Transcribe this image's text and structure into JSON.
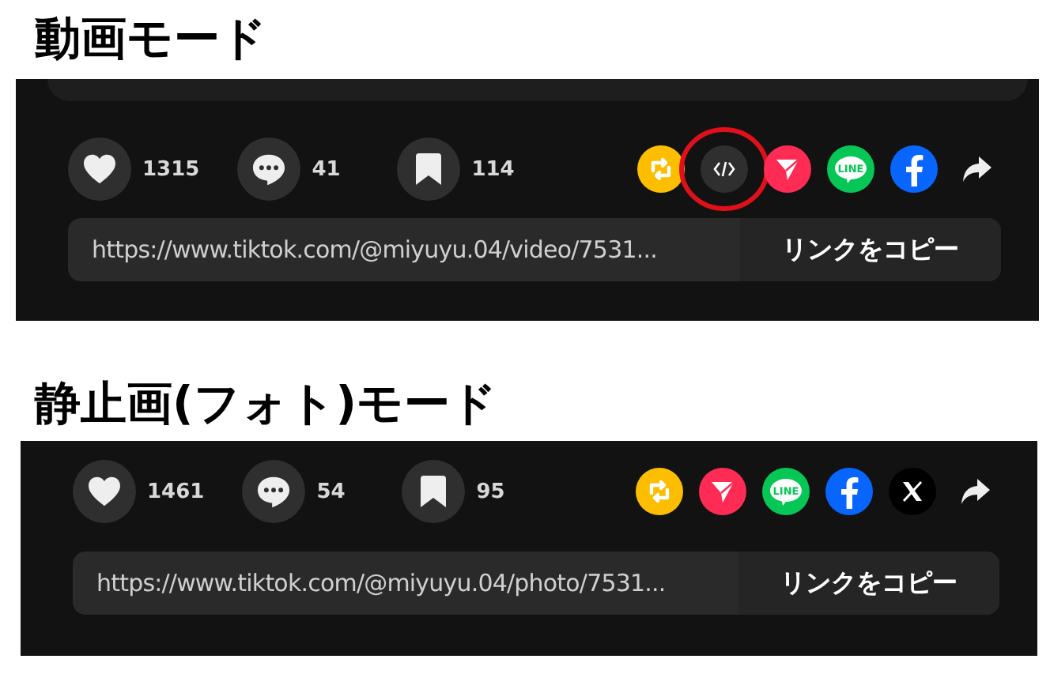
{
  "sections": [
    {
      "title": "動画モード",
      "top_card": true,
      "stats": [
        {
          "kind": "like",
          "count": "1315"
        },
        {
          "kind": "comment",
          "count": "41"
        },
        {
          "kind": "bookmark",
          "count": "114"
        }
      ],
      "share": [
        {
          "kind": "repost",
          "highlighted": false
        },
        {
          "kind": "embed",
          "highlighted": true
        },
        {
          "kind": "send",
          "highlighted": false
        },
        {
          "kind": "line",
          "label": "LINE",
          "highlighted": false
        },
        {
          "kind": "facebook",
          "highlighted": false
        },
        {
          "kind": "more",
          "highlighted": false
        }
      ],
      "url": "https://www.tiktok.com/@miyuyu.04/video/7531...",
      "copy_label": "リンクをコピー"
    },
    {
      "title": "静止画(フォト)モード",
      "top_card": false,
      "stats": [
        {
          "kind": "like",
          "count": "1461"
        },
        {
          "kind": "comment",
          "count": "54"
        },
        {
          "kind": "bookmark",
          "count": "95"
        }
      ],
      "share": [
        {
          "kind": "repost",
          "highlighted": false
        },
        {
          "kind": "send",
          "highlighted": false
        },
        {
          "kind": "line",
          "label": "LINE",
          "highlighted": false
        },
        {
          "kind": "facebook",
          "highlighted": false
        },
        {
          "kind": "x",
          "highlighted": false
        },
        {
          "kind": "more",
          "highlighted": false
        }
      ],
      "url": "https://www.tiktok.com/@miyuyu.04/photo/7531...",
      "copy_label": "リンクをコピー"
    }
  ]
}
